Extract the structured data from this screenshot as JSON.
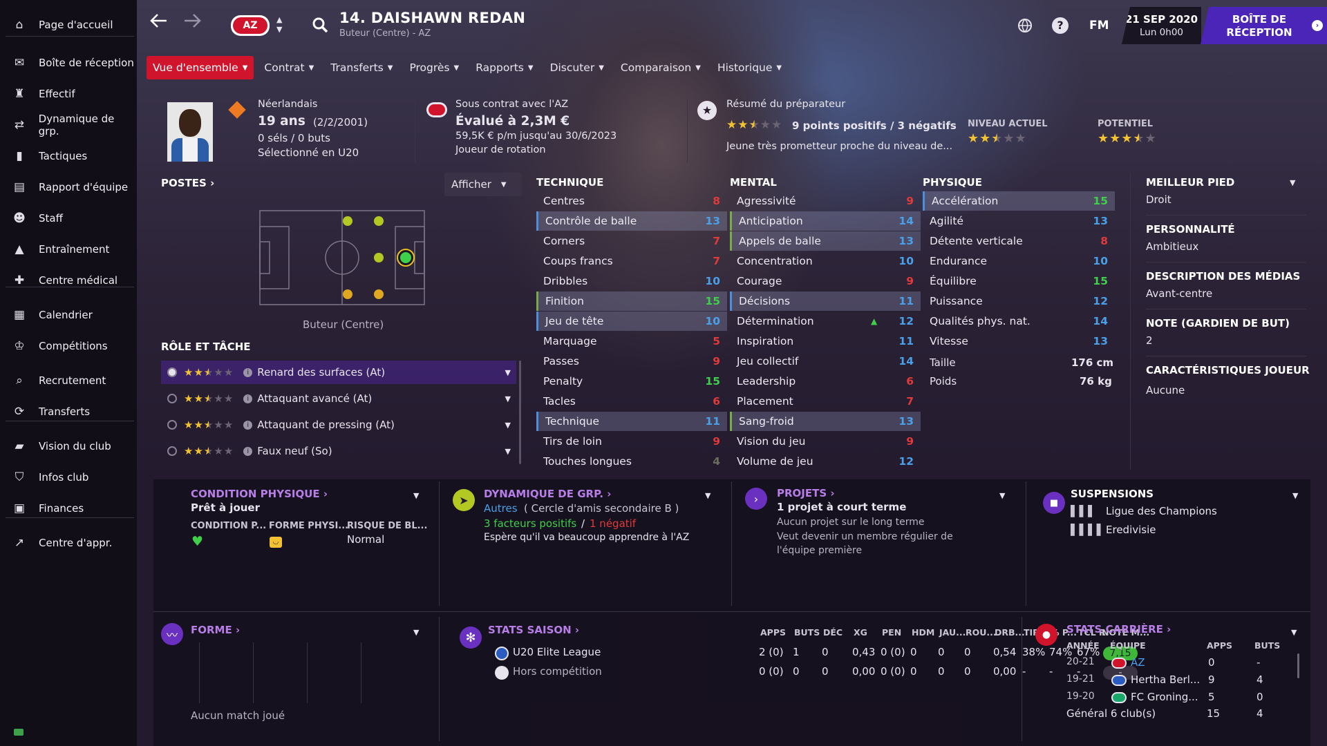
{
  "sidebar": {
    "items": [
      {
        "label": "Page d'accueil",
        "icon": "home-icon"
      },
      {
        "label": "Boîte de réception",
        "icon": "inbox-icon"
      },
      {
        "label": "Effectif",
        "icon": "squad-icon"
      },
      {
        "label": "Dynamique de grp.",
        "icon": "dynamics-icon"
      },
      {
        "label": "Tactiques",
        "icon": "tactics-icon"
      },
      {
        "label": "Rapport d'équipe",
        "icon": "report-icon"
      },
      {
        "label": "Staff",
        "icon": "staff-icon"
      },
      {
        "label": "Entraînement",
        "icon": "training-icon"
      },
      {
        "label": "Centre médical",
        "icon": "medical-icon"
      },
      {
        "label": "Calendrier",
        "icon": "calendar-icon"
      },
      {
        "label": "Compétitions",
        "icon": "trophy-icon"
      },
      {
        "label": "Recrutement",
        "icon": "scouting-icon"
      },
      {
        "label": "Transferts",
        "icon": "transfers-icon"
      },
      {
        "label": "Vision du club",
        "icon": "vision-icon"
      },
      {
        "label": "Infos club",
        "icon": "shield-icon"
      },
      {
        "label": "Finances",
        "icon": "finances-icon"
      },
      {
        "label": "Centre d'appr.",
        "icon": "academy-icon"
      }
    ]
  },
  "header": {
    "player_title": "14. DAISHAWN REDAN",
    "player_sub": "Buteur (Centre) - AZ",
    "club_badge": "AZ",
    "fm_label": "FM",
    "date": "21 SEP 2020",
    "time": "Lun 0h00",
    "inbox_button": "BOÎTE DE RÉCEPTION"
  },
  "tabs": [
    "Vue d'ensemble",
    "Contrat",
    "Transferts",
    "Progrès",
    "Rapports",
    "Discuter",
    "Comparaison",
    "Historique"
  ],
  "bio": {
    "nationality": "Néerlandais",
    "age": "19 ans",
    "dob": "(2/2/2001)",
    "caps": "0 séls / 0 buts",
    "selected": "Sélectionné en U20"
  },
  "contract": {
    "line1": "Sous contrat avec l'AZ",
    "value": "Évalué à 2,3M €",
    "wage": "59,5K € p/m jusqu'au 30/6/2023",
    "role": "Joueur de rotation"
  },
  "coach": {
    "title": "Résumé du préparateur",
    "summary": "9 points positifs / 3 négatifs",
    "desc": "Jeune très prometteur proche du niveau de...",
    "current_label": "NIVEAU ACTUEL",
    "potential_label": "POTENTIEL",
    "coach_stars": 2.5,
    "current_stars": 2.5,
    "potential_stars": 3.5
  },
  "positions": {
    "title": "POSTES",
    "show_button": "Afficher",
    "position_label": "Buteur (Centre)"
  },
  "roles": {
    "title": "RÔLE ET TÂCHE",
    "items": [
      {
        "label": "Renard des surfaces (At)",
        "stars": 2.5
      },
      {
        "label": "Attaquant avancé (At)",
        "stars": 2.5
      },
      {
        "label": "Attaquant de pressing (At)",
        "stars": 2.5
      },
      {
        "label": "Faux neuf (So)",
        "stars": 2.5
      }
    ]
  },
  "technique": {
    "title": "TECHNIQUE",
    "rows": [
      {
        "name": "Centres",
        "value": "8",
        "color": "red",
        "hl": ""
      },
      {
        "name": "Contrôle de balle",
        "value": "13",
        "color": "blue",
        "hl": "b"
      },
      {
        "name": "Corners",
        "value": "7",
        "color": "red",
        "hl": ""
      },
      {
        "name": "Coups francs",
        "value": "7",
        "color": "red",
        "hl": ""
      },
      {
        "name": "Dribbles",
        "value": "10",
        "color": "blue",
        "hl": ""
      },
      {
        "name": "Finition",
        "value": "15",
        "color": "green",
        "hl": "g"
      },
      {
        "name": "Jeu de tête",
        "value": "10",
        "color": "blue",
        "hl": "b"
      },
      {
        "name": "Marquage",
        "value": "5",
        "color": "red",
        "hl": ""
      },
      {
        "name": "Passes",
        "value": "9",
        "color": "red",
        "hl": ""
      },
      {
        "name": "Penalty",
        "value": "15",
        "color": "green",
        "hl": ""
      },
      {
        "name": "Tacles",
        "value": "6",
        "color": "red",
        "hl": ""
      },
      {
        "name": "Technique",
        "value": "11",
        "color": "blue",
        "hl": "b"
      },
      {
        "name": "Tirs de loin",
        "value": "9",
        "color": "red",
        "hl": ""
      },
      {
        "name": "Touches longues",
        "value": "4",
        "color": "dark",
        "hl": ""
      }
    ]
  },
  "mental": {
    "title": "MENTAL",
    "rows": [
      {
        "name": "Agressivité",
        "value": "9",
        "color": "red",
        "hl": ""
      },
      {
        "name": "Anticipation",
        "value": "14",
        "color": "blue",
        "hl": "g"
      },
      {
        "name": "Appels de balle",
        "value": "13",
        "color": "blue",
        "hl": "g"
      },
      {
        "name": "Concentration",
        "value": "10",
        "color": "blue",
        "hl": ""
      },
      {
        "name": "Courage",
        "value": "9",
        "color": "red",
        "hl": ""
      },
      {
        "name": "Décisions",
        "value": "11",
        "color": "blue",
        "hl": "b"
      },
      {
        "name": "Détermination",
        "value": "12",
        "color": "blue",
        "hl": ""
      },
      {
        "name": "Inspiration",
        "value": "11",
        "color": "blue",
        "hl": ""
      },
      {
        "name": "Jeu collectif",
        "value": "14",
        "color": "blue",
        "hl": ""
      },
      {
        "name": "Leadership",
        "value": "6",
        "color": "red",
        "hl": ""
      },
      {
        "name": "Placement",
        "value": "7",
        "color": "red",
        "hl": ""
      },
      {
        "name": "Sang-froid",
        "value": "13",
        "color": "blue",
        "hl": "g"
      },
      {
        "name": "Vision du jeu",
        "value": "9",
        "color": "red",
        "hl": ""
      },
      {
        "name": "Volume de jeu",
        "value": "12",
        "color": "blue",
        "hl": ""
      }
    ]
  },
  "physique": {
    "title": "PHYSIQUE",
    "rows": [
      {
        "name": "Accélération",
        "value": "15",
        "color": "green",
        "hl": "b"
      },
      {
        "name": "Agilité",
        "value": "13",
        "color": "blue",
        "hl": ""
      },
      {
        "name": "Détente verticale",
        "value": "8",
        "color": "red",
        "hl": ""
      },
      {
        "name": "Endurance",
        "value": "10",
        "color": "blue",
        "hl": ""
      },
      {
        "name": "Équilibre",
        "value": "15",
        "color": "green",
        "hl": ""
      },
      {
        "name": "Puissance",
        "value": "12",
        "color": "blue",
        "hl": ""
      },
      {
        "name": "Qualités phys. nat.",
        "value": "14",
        "color": "blue",
        "hl": ""
      },
      {
        "name": "Vitesse",
        "value": "13",
        "color": "blue",
        "hl": ""
      }
    ],
    "height_label": "Taille",
    "height": "176 cm",
    "weight_label": "Poids",
    "weight": "76 kg"
  },
  "info": {
    "foot_label": "MEILLEUR PIED",
    "foot": "Droit",
    "personality_label": "PERSONNALITÉ",
    "personality": "Ambitieux",
    "media_label": "DESCRIPTION DES MÉDIAS",
    "media": "Avant-centre",
    "gk_label": "NOTE (GARDIEN DE BUT)",
    "gk": "2",
    "traits_label": "CARACTÉRISTIQUES JOUEUR",
    "traits": "Aucune"
  },
  "condition": {
    "title": "CONDITION PHYSIQUE",
    "status": "Prêt à jouer",
    "col1": "CONDITION P...",
    "col2": "FORME PHYSI...",
    "col3": "RISQUE DE BL...",
    "risk": "Normal"
  },
  "dynamics": {
    "title": "DYNAMIQUE DE GRP.",
    "group": "Autres",
    "group_detail": "( Cercle d'amis secondaire B )",
    "positive": "3 facteurs positifs",
    "slash": "/",
    "negative": "1 négatif",
    "hope": "Espère qu'il va beaucoup apprendre à l'AZ"
  },
  "projects": {
    "title": "PROJETS",
    "count": "1 projet à court terme",
    "long": "Aucun projet sur le long terme",
    "goal": "Veut devenir un membre régulier de l'équipe première"
  },
  "suspensions": {
    "title": "SUSPENSIONS",
    "items": [
      "Ligue des Champions",
      "Eredivisie"
    ]
  },
  "form": {
    "title": "FORME",
    "empty": "Aucun match joué"
  },
  "season_stats": {
    "title": "STATS SAISON",
    "headers": [
      "APPS",
      "BUTS",
      "DÉC",
      "XG",
      "PEN",
      "HDM",
      "JAU...",
      "ROU...",
      "DRB...",
      "TIRS...",
      "% P...",
      "TCL R",
      "NOTE M..."
    ],
    "rows": [
      {
        "comp": "U20 Elite League",
        "cells": [
          "2 (0)",
          "1",
          "0",
          "0,43",
          "0 (0)",
          "0",
          "0",
          "0",
          "0,54",
          "38%",
          "74%",
          "67%"
        ],
        "rating": "7,15"
      },
      {
        "comp": "Hors compétition",
        "cells": [
          "0 (0)",
          "0",
          "0",
          "0,00",
          "0 (0)",
          "0",
          "0",
          "0",
          "0,00",
          "-",
          "-",
          "-"
        ],
        "rating": "-"
      }
    ]
  },
  "career": {
    "title": "STATS CARRIÈRE",
    "headers": [
      "ANNÉE",
      "ÉQUIPE",
      "APPS",
      "BUTS"
    ],
    "rows": [
      {
        "year": "20-21",
        "team": "AZ",
        "apps": "0",
        "goals": "-"
      },
      {
        "year": "19-21",
        "team": "Hertha Berl...",
        "apps": "9",
        "goals": "4"
      },
      {
        "year": "19-20",
        "team": "FC Groning...",
        "apps": "5",
        "goals": "0"
      }
    ],
    "total_label": "Général 6 club(s)",
    "total_apps": "15",
    "total_goals": "4"
  },
  "colors": {
    "accent": "#d0142c",
    "inbox": "#4b24b8",
    "section": "#b77ee8",
    "green": "#3fd04a",
    "red": "#e03a3a",
    "blue": "#4aa0e8"
  }
}
